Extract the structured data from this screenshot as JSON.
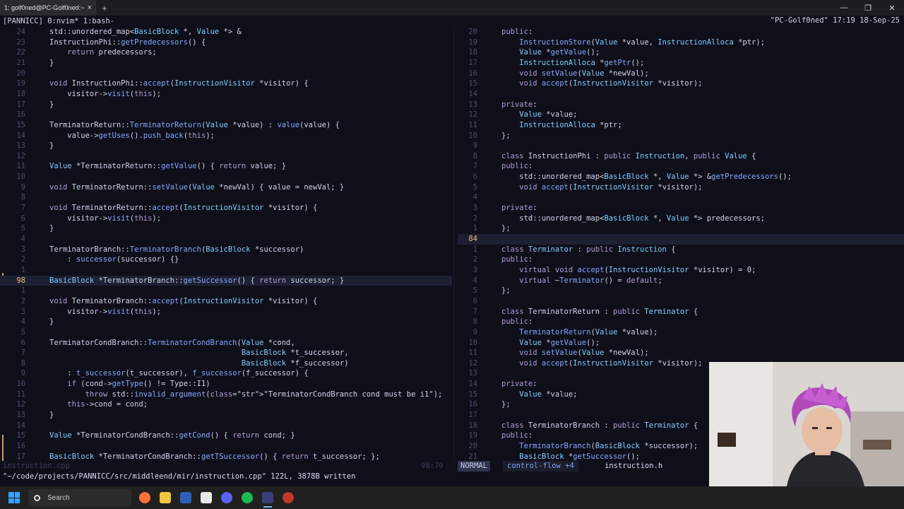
{
  "window": {
    "tab_title": "1: golf0ned@PC-Golf0ned:~",
    "new_tab": "+",
    "close": "×",
    "controls": [
      "—",
      "❐",
      "✕"
    ]
  },
  "tmux": {
    "left": "[PANNICC] 0:nvim* 1:bash-",
    "right": "\"PC-Golf0ned\" 17:19 18-Sep-25"
  },
  "left_pane": {
    "lines": [
      {
        "ln": "24",
        "code": "std::unordered_map<BasicBlock *, Value *> &"
      },
      {
        "ln": "23",
        "code": "InstructionPhi::getPredecessors() {"
      },
      {
        "ln": "22",
        "code": "    return predecessors;"
      },
      {
        "ln": "21",
        "code": "}"
      },
      {
        "ln": "20",
        "code": ""
      },
      {
        "ln": "19",
        "code": "void InstructionPhi::accept(InstructionVisitor *visitor) {"
      },
      {
        "ln": "18",
        "code": "    visitor->visit(this);"
      },
      {
        "ln": "17",
        "code": "}"
      },
      {
        "ln": "16",
        "code": ""
      },
      {
        "ln": "15",
        "code": "TerminatorReturn::TerminatorReturn(Value *value) : value(value) {"
      },
      {
        "ln": "14",
        "code": "    value->getUses().push_back(this);"
      },
      {
        "ln": "13",
        "code": "}"
      },
      {
        "ln": "12",
        "code": ""
      },
      {
        "ln": "11",
        "code": "Value *TerminatorReturn::getValue() { return value; }"
      },
      {
        "ln": "10",
        "code": ""
      },
      {
        "ln": "9",
        "code": "void TerminatorReturn::setValue(Value *newVal) { value = newVal; }"
      },
      {
        "ln": "8",
        "code": ""
      },
      {
        "ln": "7",
        "code": "void TerminatorReturn::accept(InstructionVisitor *visitor) {"
      },
      {
        "ln": "6",
        "code": "    visitor->visit(this);"
      },
      {
        "ln": "5",
        "code": "}"
      },
      {
        "ln": "4",
        "code": ""
      },
      {
        "ln": "3",
        "code": "TerminatorBranch::TerminatorBranch(BasicBlock *successor)"
      },
      {
        "ln": "2",
        "code": "    : successor(successor) {}"
      },
      {
        "ln": "1",
        "code": ""
      },
      {
        "ln": "98",
        "code": "BasicBlock *TerminatorBranch::getSuccessor() { return successor; }"
      },
      {
        "ln": "1",
        "code": ""
      },
      {
        "ln": "2",
        "code": "void TerminatorBranch::accept(InstructionVisitor *visitor) {"
      },
      {
        "ln": "3",
        "code": "    visitor->visit(this);"
      },
      {
        "ln": "4",
        "code": "}"
      },
      {
        "ln": "5",
        "code": ""
      },
      {
        "ln": "6",
        "code": "TerminatorCondBranch::TerminatorCondBranch(Value *cond,"
      },
      {
        "ln": "7",
        "code": "                                           BasicBlock *t_successor,"
      },
      {
        "ln": "8",
        "code": "                                           BasicBlock *f_successor)"
      },
      {
        "ln": "9",
        "code": "    : t_successor(t_successor), f_successor(f_successor) {"
      },
      {
        "ln": "10",
        "code": "    if (cond->getType() != Type::I1)"
      },
      {
        "ln": "11",
        "code": "        throw std::invalid_argument(\"TerminatorCondBranch cond must be i1\");"
      },
      {
        "ln": "12",
        "code": "    this->cond = cond;"
      },
      {
        "ln": "13",
        "code": "}"
      },
      {
        "ln": "14",
        "code": ""
      },
      {
        "ln": "15",
        "code": "Value *TerminatorCondBranch::getCond() { return cond; }"
      },
      {
        "ln": "16",
        "code": ""
      },
      {
        "ln": "17",
        "code": "BasicBlock *TerminatorCondBranch::getTSuccessor() { return t_successor; };"
      }
    ]
  },
  "right_pane": {
    "lines": [
      {
        "ln": "20",
        "code": "public:"
      },
      {
        "ln": "19",
        "code": "    InstructionStore(Value *value, InstructionAlloca *ptr);"
      },
      {
        "ln": "18",
        "code": "    Value *getValue();"
      },
      {
        "ln": "17",
        "code": "    InstructionAlloca *getPtr();"
      },
      {
        "ln": "16",
        "code": "    void setValue(Value *newVal);"
      },
      {
        "ln": "15",
        "code": "    void accept(InstructionVisitor *visitor);"
      },
      {
        "ln": "14",
        "code": ""
      },
      {
        "ln": "13",
        "code": "private:"
      },
      {
        "ln": "12",
        "code": "    Value *value;"
      },
      {
        "ln": "11",
        "code": "    InstructionAlloca *ptr;"
      },
      {
        "ln": "10",
        "code": "};"
      },
      {
        "ln": "9",
        "code": ""
      },
      {
        "ln": "8",
        "code": "class InstructionPhi : public Instruction, public Value {"
      },
      {
        "ln": "7",
        "code": "public:"
      },
      {
        "ln": "6",
        "code": "    std::unordered_map<BasicBlock *, Value *> &getPredecessors();"
      },
      {
        "ln": "5",
        "code": "    void accept(InstructionVisitor *visitor);"
      },
      {
        "ln": "4",
        "code": ""
      },
      {
        "ln": "3",
        "code": "private:"
      },
      {
        "ln": "2",
        "code": "    std::unordered_map<BasicBlock *, Value *> predecessors;"
      },
      {
        "ln": "1",
        "code": "};"
      },
      {
        "ln": "84",
        "code": ""
      },
      {
        "ln": "1",
        "code": "class Terminator : public Instruction {"
      },
      {
        "ln": "2",
        "code": "public:"
      },
      {
        "ln": "3",
        "code": "    virtual void accept(InstructionVisitor *visitor) = 0;"
      },
      {
        "ln": "4",
        "code": "    virtual ~Terminator() = default;"
      },
      {
        "ln": "5",
        "code": "};"
      },
      {
        "ln": "6",
        "code": ""
      },
      {
        "ln": "7",
        "code": "class TerminatorReturn : public Terminator {"
      },
      {
        "ln": "8",
        "code": "public:"
      },
      {
        "ln": "9",
        "code": "    TerminatorReturn(Value *value);"
      },
      {
        "ln": "10",
        "code": "    Value *getValue();"
      },
      {
        "ln": "11",
        "code": "    void setValue(Value *newVal);"
      },
      {
        "ln": "12",
        "code": "    void accept(InstructionVisitor *visitor);"
      },
      {
        "ln": "13",
        "code": ""
      },
      {
        "ln": "14",
        "code": "private:"
      },
      {
        "ln": "15",
        "code": "    Value *value;"
      },
      {
        "ln": "16",
        "code": "};"
      },
      {
        "ln": "17",
        "code": ""
      },
      {
        "ln": "18",
        "code": "class TerminatorBranch : public Terminator {"
      },
      {
        "ln": "19",
        "code": "public:"
      },
      {
        "ln": "20",
        "code": "    TerminatorBranch(BasicBlock *successor);"
      },
      {
        "ln": "21",
        "code": "    BasicBlock *getSuccessor();"
      }
    ]
  },
  "statusline": {
    "left_file": "instruction.cpp",
    "left_pos": "98:70",
    "mode": "NORMAL",
    "branch": " control-flow  +4",
    "right_file": "instruction.h"
  },
  "cmdline": "\"~/code/projects/PANNICC/src/middleend/mir/instruction.cpp\" 122L, 3878B written",
  "taskbar": {
    "search_label": "Search",
    "apps": [
      {
        "name": "firefox",
        "color": "#ff7139"
      },
      {
        "name": "file-explorer",
        "color": "#f4c542"
      },
      {
        "name": "word",
        "color": "#2b5fbd"
      },
      {
        "name": "notion",
        "color": "#e8e8e8"
      },
      {
        "name": "discord",
        "color": "#5865f2"
      },
      {
        "name": "spotify",
        "color": "#1db954"
      },
      {
        "name": "terminal",
        "color": "#3a3f7a"
      },
      {
        "name": "obs",
        "color": "#c0392b"
      }
    ]
  },
  "colors": {
    "background": "#0f0f1a",
    "accent": "#7aa2f7",
    "cursorline": "#1d1f33"
  }
}
